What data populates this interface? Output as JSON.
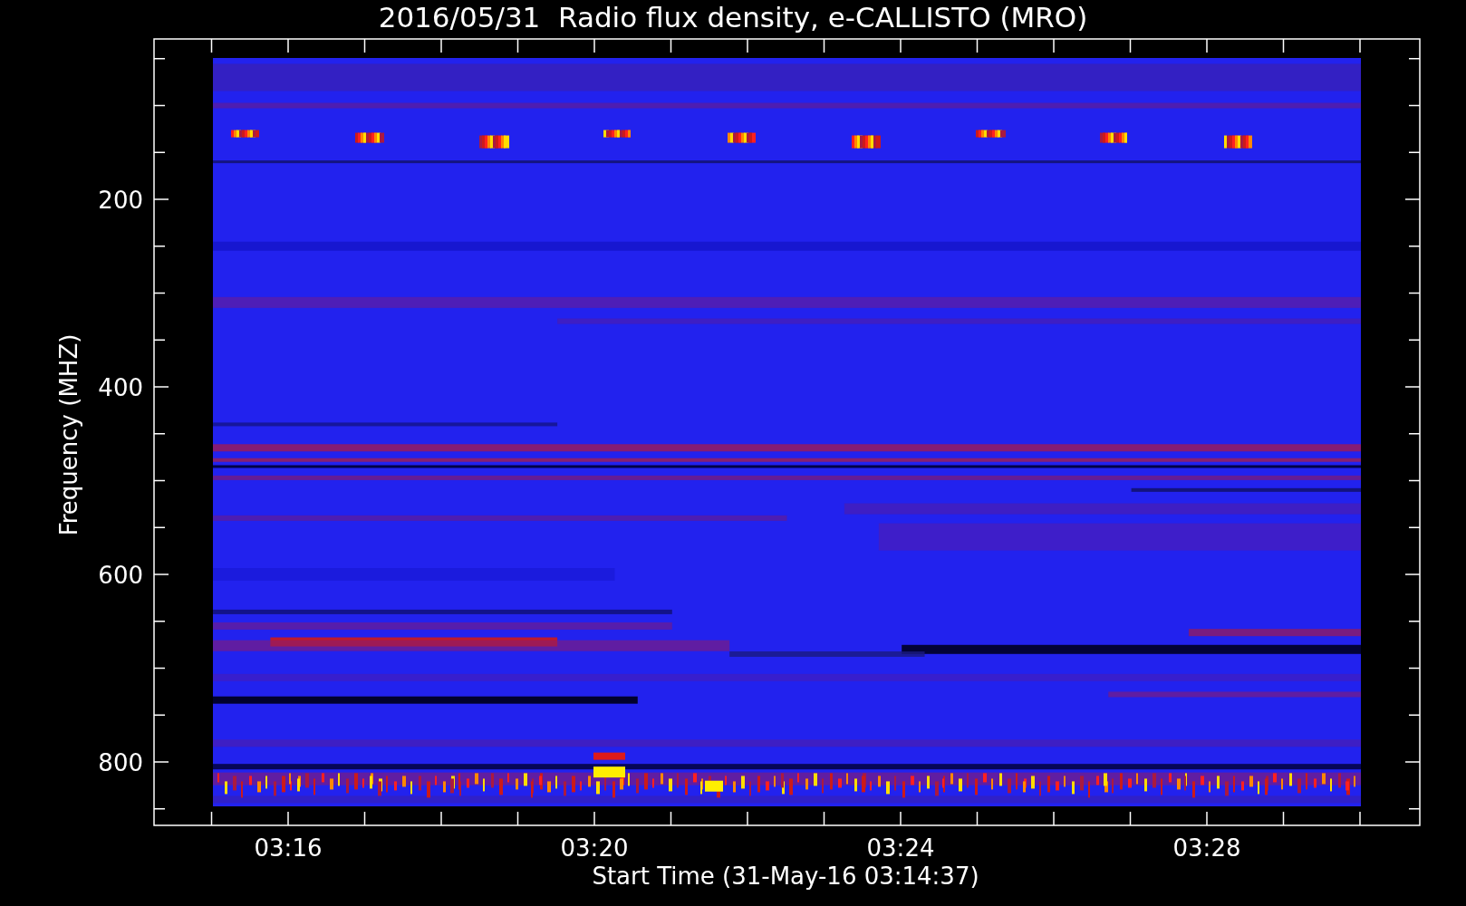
{
  "title": "2016/05/31  Radio flux density, e-CALLISTO (MRO)",
  "plot": {
    "ylabel": "Frequency (MHZ)",
    "xlabel": "Start Time (31-May-16 03:14:37)",
    "yticks": [
      "200",
      "400",
      "600",
      "800"
    ],
    "xticks": [
      "03:16",
      "03:20",
      "03:24",
      "03:28"
    ]
  }
}
